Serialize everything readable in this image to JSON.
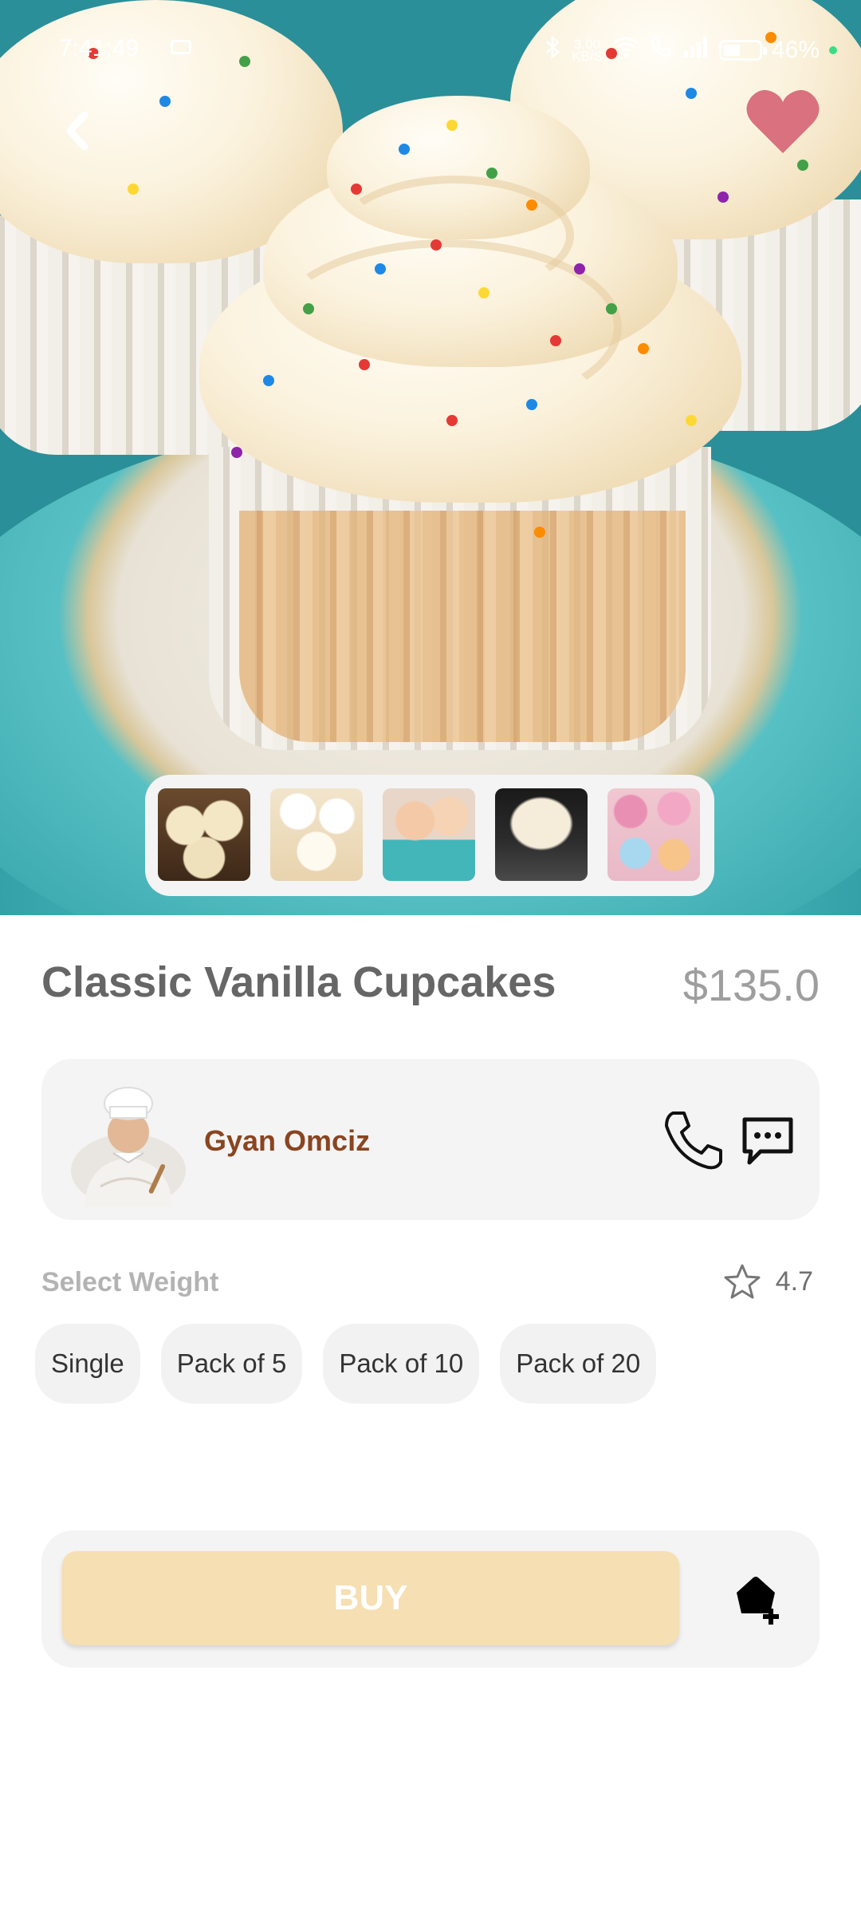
{
  "status_bar": {
    "time": "7:41:49",
    "net_speed_value": "3.00",
    "net_speed_unit": "KB/S",
    "battery": "46%"
  },
  "product": {
    "title": "Classic Vanilla Cupcakes",
    "price": "$135.0",
    "thumbnails": [
      "cupcakes-chocolate",
      "cupcakes-sprinkles",
      "cupcakes-plate",
      "cupcake-chocolate-base",
      "cupcakes-colorful"
    ],
    "favorited": true
  },
  "seller": {
    "name": "Gyan Omciz"
  },
  "weight": {
    "label": "Select Weight",
    "rating": "4.7",
    "options": [
      "Single",
      "Pack of 5",
      "Pack of 10",
      "Pack of 20"
    ]
  },
  "actions": {
    "buy_label": "BUY"
  },
  "colors": {
    "accent_heart": "#d9717f",
    "seller_name": "#8a4520",
    "buy_button": "#f5dfb3"
  }
}
